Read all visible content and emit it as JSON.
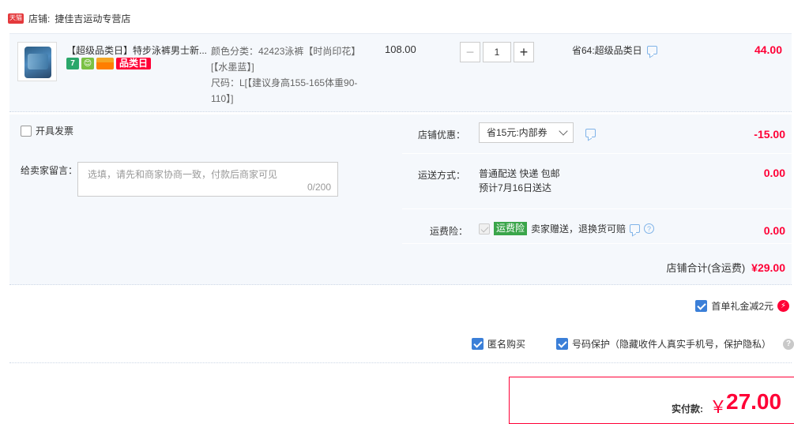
{
  "shop": {
    "badge": "天猫",
    "label": "店铺:",
    "name": "捷佳吉运动专营店"
  },
  "item": {
    "title": "【超级品类日】特步泳裤男士新...",
    "tags": [
      "7",
      "😊",
      "品类日"
    ],
    "sku_line1": "颜色分类：42423泳裤【时尚印花】[【水墨蓝】]",
    "sku_line2": "尺码：L[【建议身高155-165体重90-110】]",
    "price": "108.00",
    "quantity": "1",
    "saving": "省64:超级品类日",
    "total": "44.00"
  },
  "order": {
    "invoice_label": "开具发票",
    "memo_label": "给卖家留言：",
    "memo_placeholder": "选填，请先和商家协商一致，付款后商家可见",
    "memo_count": "0/200",
    "discount_label": "店铺优惠：",
    "discount_value": "省15元:内部券",
    "discount_amount": "-15.00",
    "shipping_label": "运送方式：",
    "shipping_line1": "普通配送 快递 包邮",
    "shipping_line2": "预计7月16日送达",
    "shipping_amount": "0.00",
    "insurance_label": "运费险：",
    "insurance_badge": "运费险",
    "insurance_text": "卖家赠送，退换货可赔",
    "insurance_amount": "0.00",
    "shop_total_label": "店铺合计(含运费)",
    "shop_total_value": "¥29.00"
  },
  "gift": {
    "label": "首单礼金减2元"
  },
  "privacy": {
    "anonymous_label": "匿名购买",
    "phone_protect_label": "号码保护（隐藏收件人真实手机号，保护隐私）"
  },
  "payment": {
    "label": "实付款:",
    "currency": "￥",
    "amount": "27.00"
  },
  "colors": {
    "accent_red": "#ff0036",
    "check_blue": "#3b7fd8",
    "insurance_green": "#3aa54a"
  }
}
